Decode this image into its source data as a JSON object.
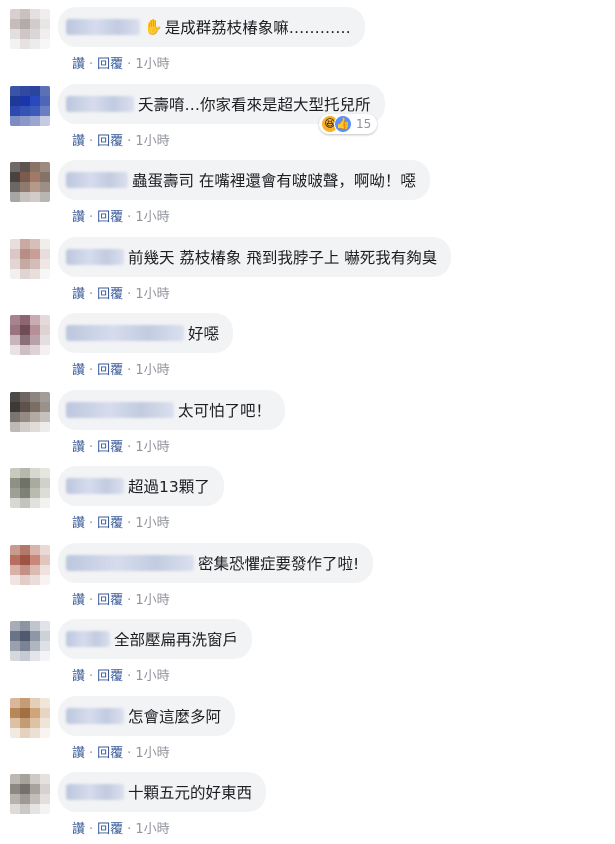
{
  "actions": {
    "like_label": "讚",
    "reply_label": "回覆",
    "time": "1小時",
    "separator": "·"
  },
  "comments": [
    {
      "text": "是成群荔枝椿象嘛…………",
      "name_width": 74,
      "hand_icon": "✋",
      "avatar": [
        "#d8d0d0",
        "#c9c0c0",
        "#e5e0e0",
        "#efeded",
        "#c6bcbc",
        "#b5aaaa",
        "#d3cccc",
        "#e8e5e5",
        "#e3dfdf",
        "#cfc7c7",
        "#dcd6d6",
        "#f0eeee",
        "#f3f2f2",
        "#e6e2e2",
        "#ececec",
        "#f7f7f7"
      ]
    },
    {
      "text": "夭壽唷…你家看來是超大型托兒所",
      "name_width": 68,
      "reaction": {
        "count": "15",
        "haha_icon": "😆",
        "like_icon": "👍"
      },
      "avatar": [
        "#3a55a8",
        "#2f4aa0",
        "#2a44a0",
        "#5c70b5",
        "#1f3a96",
        "#1a36a8",
        "#2a48c0",
        "#4d66b8",
        "#2b49ae",
        "#3652b5",
        "#3d5ab8",
        "#6a7fc2",
        "#7d8dc4",
        "#8a98c8",
        "#9aa6cf",
        "#c5cbe3"
      ]
    },
    {
      "text": "蟲蛋壽司 在嘴裡還會有啵啵聲，啊呦！噁",
      "name_width": 62,
      "avatar": [
        "#6f6a66",
        "#5d544f",
        "#8a7468",
        "#9d8a80",
        "#4a423d",
        "#7b5b4c",
        "#a07a66",
        "#85736a",
        "#6b6762",
        "#8e7a6e",
        "#b59a8a",
        "#9b8f88",
        "#a8a6a4",
        "#c8c2be",
        "#d2cbc7",
        "#b9b5b2"
      ]
    },
    {
      "text": "前幾天 荔枝椿象 飛到我脖子上 嚇死我有夠臭",
      "name_width": 58,
      "avatar": [
        "#e9dede",
        "#c9a9a2",
        "#d6bfba",
        "#f2eded",
        "#d9c8c4",
        "#b58e85",
        "#c79f96",
        "#e7dddb",
        "#e2d6d4",
        "#c5aaa4",
        "#d3bdb8",
        "#eee7e6",
        "#f3efee",
        "#e0d4d2",
        "#e8dfdd",
        "#f8f6f6"
      ]
    },
    {
      "text": "好噁",
      "name_width": 118,
      "avatar": [
        "#a7838c",
        "#8d6671",
        "#c7adb3",
        "#e5d9dc",
        "#9a7480",
        "#6e4d58",
        "#b59099",
        "#dfd2d5",
        "#c9b4ba",
        "#8b6f78",
        "#b8a1a8",
        "#e6dde0",
        "#e9e1e3",
        "#cdbfc3",
        "#ded2d6",
        "#f4f0f1"
      ]
    },
    {
      "text": "太可怕了吧！",
      "name_width": 108,
      "avatar": [
        "#4c4a48",
        "#6e6460",
        "#8d8580",
        "#a39c98",
        "#3d3937",
        "#5d524c",
        "#7a6e66",
        "#9b918b",
        "#7c746f",
        "#968b84",
        "#b3aaa4",
        "#c7c1bd",
        "#bfb9b5",
        "#d3ceca",
        "#e0dcd9",
        "#eeeceb"
      ]
    },
    {
      "text": "超過13顆了",
      "name_width": 58,
      "avatar": [
        "#c9c9c0",
        "#b7b8ad",
        "#d7d8d0",
        "#e6e6e0",
        "#8e9185",
        "#6f7366",
        "#a8ab9f",
        "#d0d1c9",
        "#9da094",
        "#7e8175",
        "#b9bbb0",
        "#dcddd6",
        "#d8d8d2",
        "#c3c4bc",
        "#e2e2dc",
        "#f2f2ee"
      ]
    },
    {
      "text": "密集恐懼症要發作了啦!",
      "name_width": 128,
      "avatar": [
        "#c99b8f",
        "#b4786a",
        "#d8b5ab",
        "#ead9d4",
        "#b86f60",
        "#9d5446",
        "#c8877a",
        "#e2c5bd",
        "#d9b1a8",
        "#c49085",
        "#dbbab2",
        "#efe2de",
        "#efe4e1",
        "#e2cdc7",
        "#eadcd8",
        "#f8f3f1"
      ]
    },
    {
      "text": "全部壓扁再洗窗戶",
      "name_width": 44,
      "avatar": [
        "#a7acb6",
        "#8d95a4",
        "#c0c5ce",
        "#e0e3e8",
        "#6b7486",
        "#4f5a6e",
        "#8e97a7",
        "#cdd1d8",
        "#9aa1ad",
        "#7b8494",
        "#b0b6c0",
        "#dde0e5",
        "#d5d8dd",
        "#c6cad2",
        "#e3e5e9",
        "#f3f4f6"
      ]
    },
    {
      "text": "怎會這麼多阿",
      "name_width": 58,
      "avatar": [
        "#d8b89a",
        "#c79c74",
        "#e6cfb8",
        "#f1e6da",
        "#b98757",
        "#a06f42",
        "#cfa57c",
        "#e9d6c2",
        "#dcc1a6",
        "#c49b72",
        "#ddc2a5",
        "#f0e4d6",
        "#f2e9df",
        "#e4d2bf",
        "#ece0d2",
        "#f8f4ef"
      ]
    },
    {
      "text": "十顆五元的好東西",
      "name_width": 58,
      "avatar": [
        "#bdb8b4",
        "#a8a29d",
        "#cfcac6",
        "#e4e1df",
        "#8e8883",
        "#77716c",
        "#a9a39e",
        "#d6d2cf",
        "#b7b2ae",
        "#9f9994",
        "#c3beba",
        "#e2dfdc",
        "#dedbd9",
        "#ccc8c5",
        "#e6e4e2",
        "#f4f3f2"
      ]
    }
  ]
}
